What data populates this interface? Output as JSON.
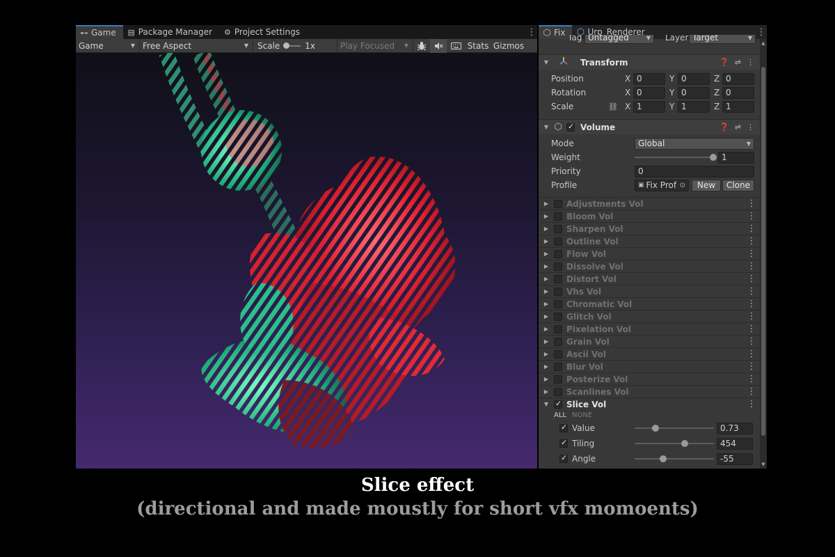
{
  "game_window": {
    "tabs": [
      {
        "label": "Game",
        "icon": "gamepad-icon"
      },
      {
        "label": "Package Manager",
        "icon": "package-icon"
      },
      {
        "label": "Project Settings",
        "icon": "gear-icon"
      }
    ],
    "toolbar": {
      "display": "Game",
      "aspect": "Free Aspect",
      "scale_label": "Scale",
      "scale_value": "1x",
      "play_mode": "Play Focused",
      "stats": "Stats",
      "gizmos": "Gizmos"
    }
  },
  "inspector": {
    "tabs": [
      {
        "label": "Fix",
        "icon": "cube-icon"
      },
      {
        "label": "Urp_Renderer",
        "icon": "asset-icon"
      }
    ],
    "tag_label": "Tag",
    "tag_value": "Untagged",
    "layer_label": "Layer",
    "layer_value": "Target",
    "transform": {
      "title": "Transform",
      "position_label": "Position",
      "rotation_label": "Rotation",
      "scale_label": "Scale",
      "axes": [
        "X",
        "Y",
        "Z"
      ],
      "position": [
        "0",
        "0",
        "0"
      ],
      "rotation": [
        "0",
        "0",
        "0"
      ],
      "scale": [
        "1",
        "1",
        "1"
      ]
    },
    "volume": {
      "title": "Volume",
      "mode_label": "Mode",
      "mode_value": "Global",
      "weight_label": "Weight",
      "weight_value": "1",
      "weight_fraction": 1.0,
      "priority_label": "Priority",
      "priority_value": "0",
      "profile_label": "Profile",
      "profile_value": "Fix Prof",
      "new_button": "New",
      "clone_button": "Clone"
    },
    "volumes": [
      {
        "name": "Adjustments Vol",
        "enabled": false
      },
      {
        "name": "Bloom Vol",
        "enabled": false
      },
      {
        "name": "Sharpen Vol",
        "enabled": false
      },
      {
        "name": "Outline Vol",
        "enabled": false
      },
      {
        "name": "Flow Vol",
        "enabled": false
      },
      {
        "name": "Dissolve Vol",
        "enabled": false
      },
      {
        "name": "Distort Vol",
        "enabled": false
      },
      {
        "name": "Vhs Vol",
        "enabled": false
      },
      {
        "name": "Chromatic Vol",
        "enabled": false
      },
      {
        "name": "Glitch Vol",
        "enabled": false
      },
      {
        "name": "Pixelation Vol",
        "enabled": false
      },
      {
        "name": "Grain Vol",
        "enabled": false
      },
      {
        "name": "Ascii Vol",
        "enabled": false
      },
      {
        "name": "Blur Vol",
        "enabled": false
      },
      {
        "name": "Posterize Vol",
        "enabled": false
      },
      {
        "name": "Scanlines Vol",
        "enabled": false
      }
    ],
    "slice_vol": {
      "name": "Slice Vol",
      "all_label": "ALL",
      "none_label": "NONE",
      "params": [
        {
          "label": "Value",
          "value": "0.73",
          "fraction": 0.26
        },
        {
          "label": "Tiling",
          "value": "454",
          "fraction": 0.63
        },
        {
          "label": "Angle",
          "value": "-55",
          "fraction": 0.36
        }
      ]
    }
  },
  "caption": {
    "title": "Slice effect",
    "subtitle": "(directional and made moustly for short vfx momoents)"
  },
  "colors": {
    "accent_blue": "#3a79bb",
    "effect_red": "#ff3a4a",
    "effect_green": "#3ee6a8",
    "sky_top": "#101018",
    "sky_bottom": "#452a6e"
  }
}
